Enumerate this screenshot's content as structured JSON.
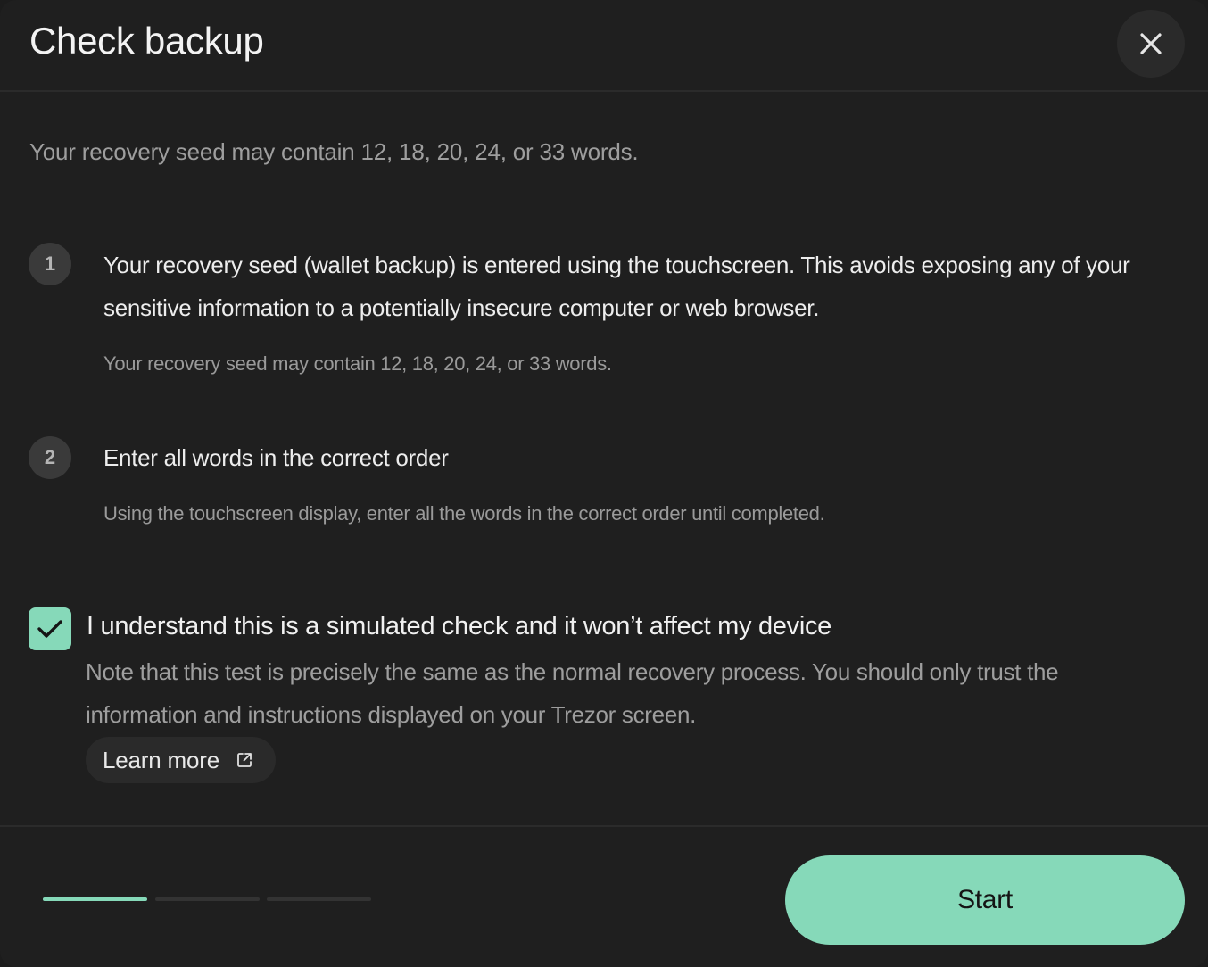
{
  "dialog": {
    "title": "Check backup",
    "close_icon": "close-icon"
  },
  "intro": "Your recovery seed may contain 12, 18, 20, 24, or 33 words.",
  "steps": [
    {
      "number": "1",
      "title": "Your recovery seed (wallet backup) is entered using the touchscreen. This avoids exposing any of your sensitive information to a potentially insecure computer or web browser.",
      "description": "Your recovery seed may contain 12, 18, 20, 24, or 33 words."
    },
    {
      "number": "2",
      "title": "Enter all words in the correct order",
      "description": "Using the touchscreen display, enter all the words in the correct order until completed."
    }
  ],
  "acknowledgement": {
    "checked": true,
    "label": "I understand this is a simulated check and it won’t affect my device",
    "note": "Note that this test is precisely the same as the normal recovery process. You should only trust the information and instructions displayed on your Trezor screen.",
    "learn_more_label": "Learn more",
    "learn_more_icon": "external-link-icon"
  },
  "footer": {
    "progress": {
      "total_steps": 3,
      "current_step": 1
    },
    "start_label": "Start"
  },
  "colors": {
    "accent": "#86d9b9",
    "background": "#1f1f1f",
    "surface": "#2a2a2a"
  }
}
